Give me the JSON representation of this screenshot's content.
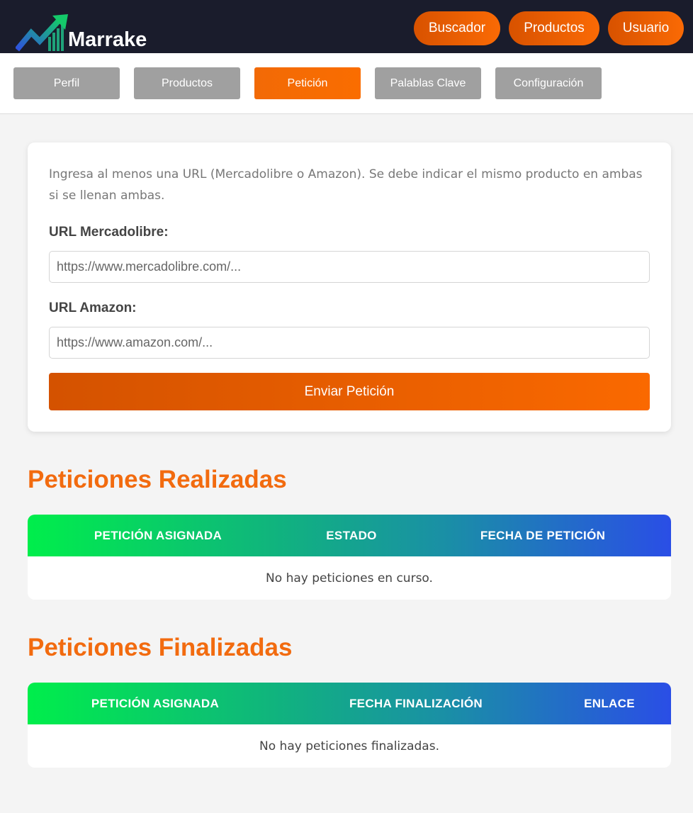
{
  "header": {
    "brand": "Marrake",
    "logo_icon": "growth-chart-arrow-icon",
    "nav": [
      {
        "label": "Buscador"
      },
      {
        "label": "Productos"
      },
      {
        "label": "Usuario"
      }
    ]
  },
  "tabs": [
    {
      "label": "Perfil",
      "active": false
    },
    {
      "label": "Productos",
      "active": false
    },
    {
      "label": "Petición",
      "active": true
    },
    {
      "label": "Palablas Clave",
      "active": false
    },
    {
      "label": "Configuración",
      "active": false
    }
  ],
  "form": {
    "intro": "Ingresa al menos una URL (Mercadolibre o Amazon). Se debe indicar el mismo producto en ambas si se llenan ambas.",
    "ml_label": "URL Mercadolibre:",
    "ml_placeholder": "https://www.mercadolibre.com/...",
    "ml_value": "",
    "amazon_label": "URL Amazon:",
    "amazon_placeholder": "https://www.amazon.com/...",
    "amazon_value": "",
    "submit_label": "Enviar Petición"
  },
  "realizadas": {
    "title": "Peticiones Realizadas",
    "columns": [
      "PETICIÓN ASIGNADA",
      "ESTADO",
      "FECHA DE PETICIÓN"
    ],
    "empty_message": "No hay peticiones en curso."
  },
  "finalizadas": {
    "title": "Peticiones Finalizadas",
    "columns": [
      "PETICIÓN ASIGNADA",
      "FECHA FINALIZACIÓN",
      "ENLACE"
    ],
    "empty_message": "No hay peticiones finalizadas."
  },
  "colors": {
    "accent_orange": "#f26b0f",
    "header_bg": "#1a1c2c",
    "tab_inactive": "#a0a0a0",
    "table_gradient_start": "#00ee4b",
    "table_gradient_end": "#2a4ee6"
  }
}
